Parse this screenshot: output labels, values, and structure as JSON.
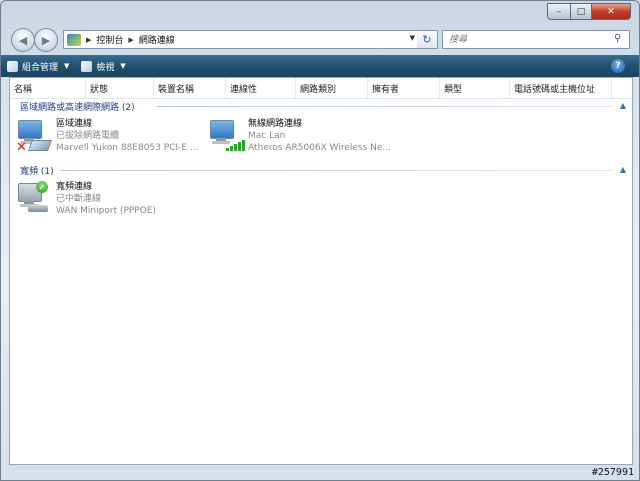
{
  "window": {
    "caption": {
      "minimize": "–",
      "maximize": "□",
      "close": "✕"
    }
  },
  "nav": {
    "back_icon": "back-arrow-icon",
    "forward_icon": "forward-arrow-icon",
    "address": {
      "breadcrumbs": [
        "控制台",
        "網路連線"
      ]
    },
    "search_placeholder": "搜尋"
  },
  "toolbar": {
    "organize_label": "組合管理",
    "views_label": "檢視",
    "help_label": "?"
  },
  "columns": [
    "名稱",
    "狀態",
    "裝置名稱",
    "連線性",
    "網路類別",
    "擁有者",
    "類型",
    "電話號碼或主機位址"
  ],
  "groups": [
    {
      "title": "區域網路或高速網際網路 (2)",
      "items": [
        {
          "name": "區域連線",
          "status": "已拔除網路電纜",
          "device": "Marvell Yukon 88E8053 PCI-E ..."
        },
        {
          "name": "無線網路連線",
          "status": "Mac Lan",
          "device": "Atheros AR5006X Wireless Ne..."
        }
      ]
    },
    {
      "title": "寬頻 (1)",
      "items": [
        {
          "name": "寬頻連線",
          "status": "已中斷連線",
          "device": "WAN Miniport (PPPOE)"
        }
      ]
    }
  ],
  "watermark": "#257991"
}
